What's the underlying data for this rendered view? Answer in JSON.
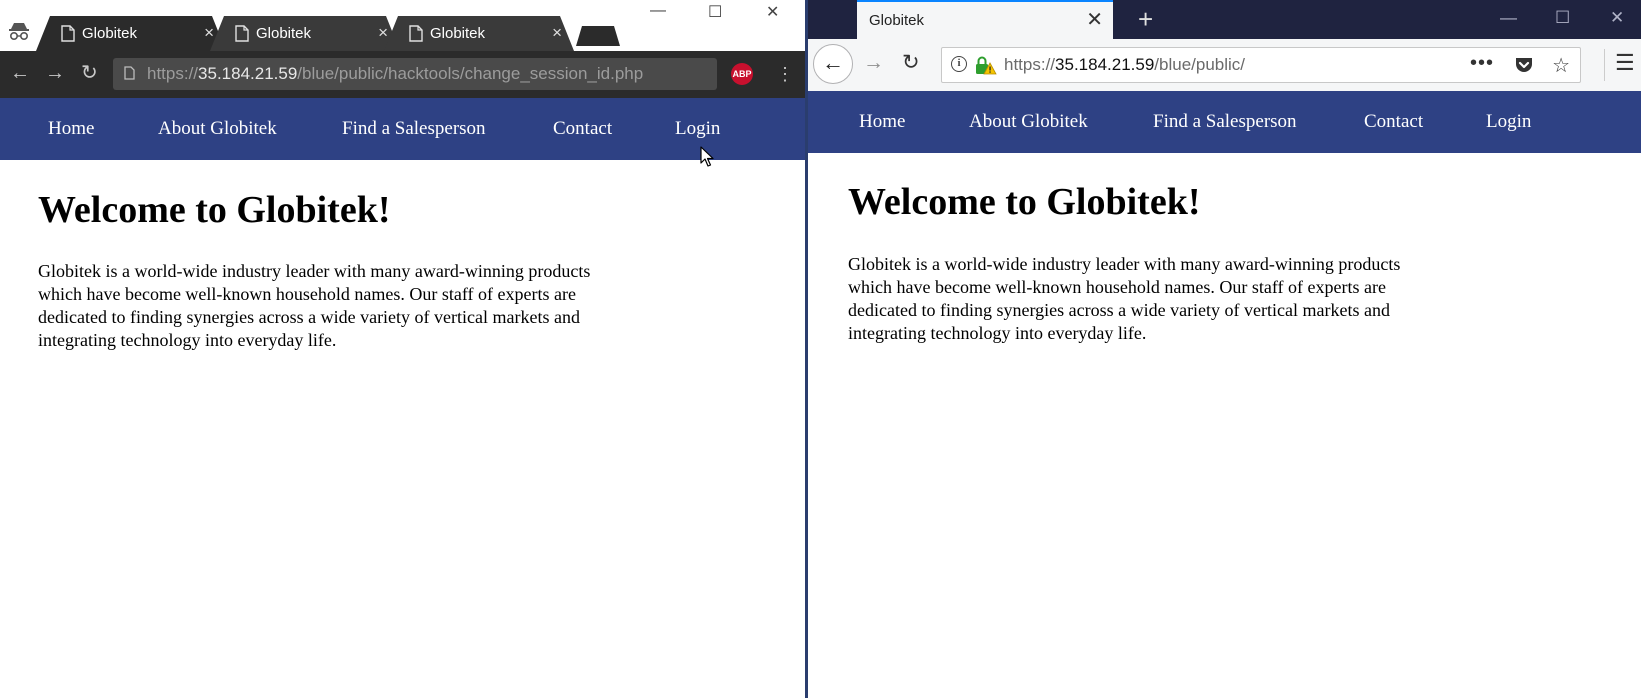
{
  "left_browser": {
    "tabs": [
      {
        "title": "Globitek"
      },
      {
        "title": "Globitek"
      },
      {
        "title": "Globitek"
      }
    ],
    "tab_close_glyph": "×",
    "address": {
      "scheme": "https://",
      "host": "35.184.21.59",
      "path": "/blue/public/hacktools/change_session_id.php"
    },
    "extension_badge": "ABP",
    "icons": {
      "back": "←",
      "forward": "→",
      "reload": "↻",
      "menu": "⋮",
      "minimize": "—",
      "maximize": "☐",
      "close": "✕"
    }
  },
  "right_browser": {
    "tab": {
      "title": "Globitek"
    },
    "tab_close_glyph": "✕",
    "new_tab_glyph": "+",
    "address": {
      "scheme": "https://",
      "host": "35.184.21.59",
      "path": "/blue/public/"
    },
    "icons": {
      "back": "←",
      "forward": "→",
      "reload": "↻",
      "page_actions": "•••",
      "bookmark": "☆",
      "menu": "☰",
      "minimize": "—",
      "maximize": "☐",
      "close": "✕"
    }
  },
  "site": {
    "nav": [
      "Home",
      "About Globitek",
      "Find a Salesperson",
      "Contact",
      "Login"
    ],
    "heading": "Welcome to Globitek!",
    "intro_lines": [
      "Globitek is a world-wide industry leader with many award-winning products",
      "which have become well-known household names. Our staff of experts are",
      "dedicated to finding synergies across a wide variety of vertical markets and",
      "integrating technology into everyday life."
    ]
  },
  "colors": {
    "nav_bar": "#2e4184",
    "chrome_toolbar": "#2b2b2b",
    "firefox_titlebar": "#1f2340",
    "firefox_tab_accent": "#0a84ff",
    "abp_badge": "#c8102e"
  }
}
